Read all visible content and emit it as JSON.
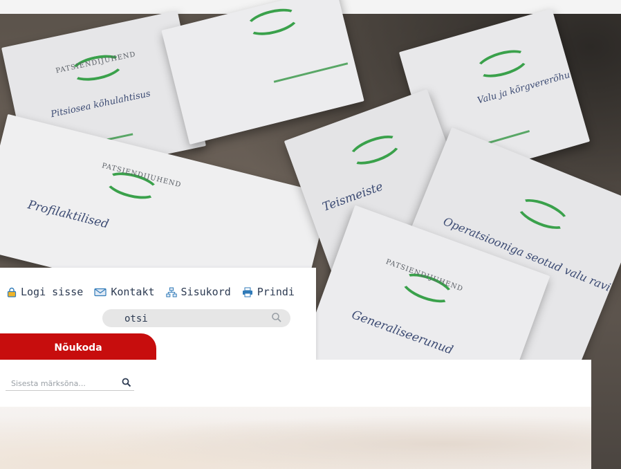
{
  "nav": {
    "links": [
      {
        "label": "Logi sisse",
        "icon": "lock-icon"
      },
      {
        "label": "Kontakt",
        "icon": "envelope-icon"
      },
      {
        "label": "Sisukord",
        "icon": "sitemap-icon"
      },
      {
        "label": "Prindi",
        "icon": "printer-icon"
      }
    ]
  },
  "search": {
    "placeholder": "otsi",
    "icon": "search-icon"
  },
  "cta": {
    "label": "Nõukoda"
  },
  "keyword_search": {
    "placeholder": "Sisesta märksõna...",
    "icon": "search-icon"
  },
  "photo": {
    "brochure_titles": [
      "Profilaktilised",
      "Operatsiooniga seotud valu ravi",
      "Generaliseerunud",
      "Teismeiste",
      "Valu ja kõrgvererõhu",
      "Pitsiosea kõhulahtisus"
    ],
    "logo_text": "PATSIENDIJUHEND"
  },
  "colors": {
    "accent_red": "#c70d0d",
    "brochure_green": "#3aa14b",
    "brochure_blue": "#3c4b73",
    "nav_text": "#2d3b52"
  }
}
